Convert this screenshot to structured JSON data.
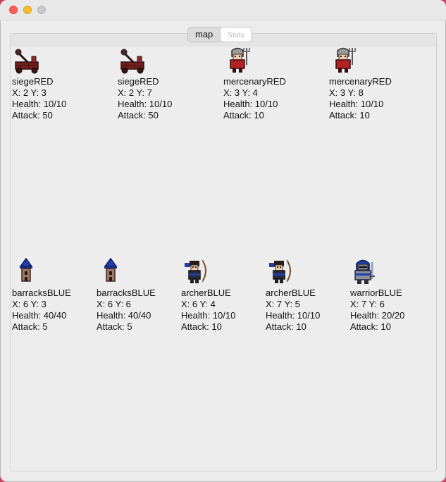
{
  "tabs": {
    "map": "map",
    "stats": "Stats"
  },
  "units_red": [
    {
      "name": "siegeRED",
      "coords": "X: 2 Y: 3",
      "health": "Health: 10/10",
      "attack": "Attack: 50",
      "icon": "catapult-icon"
    },
    {
      "name": "siegeRED",
      "coords": "X: 2 Y: 7",
      "health": "Health: 10/10",
      "attack": "Attack: 50",
      "icon": "catapult-icon"
    },
    {
      "name": "mercenaryRED",
      "coords": "X: 3 Y: 4",
      "health": "Health: 10/10",
      "attack": "Attack: 10",
      "icon": "mercenary-icon"
    },
    {
      "name": "mercenaryRED",
      "coords": "X: 3 Y: 8",
      "health": "Health: 10/10",
      "attack": "Attack: 10",
      "icon": "mercenary-icon"
    }
  ],
  "units_blue": [
    {
      "name": "barracksBLUE",
      "coords": "X: 6 Y: 3",
      "health": "Health: 40/40",
      "attack": "Attack: 5",
      "icon": "tower-icon"
    },
    {
      "name": "barracksBLUE",
      "coords": "X: 6 Y: 6",
      "health": "Health: 40/40",
      "attack": "Attack: 5",
      "icon": "tower-icon"
    },
    {
      "name": "archerBLUE",
      "coords": "X: 6 Y: 4",
      "health": "Health: 10/10",
      "attack": "Attack: 10",
      "icon": "archer-icon"
    },
    {
      "name": "archerBLUE",
      "coords": "X: 7 Y: 5",
      "health": "Health: 10/10",
      "attack": "Attack: 10",
      "icon": "archer-icon"
    },
    {
      "name": "warriorBLUE",
      "coords": "X: 7 Y: 6",
      "health": "Health: 20/20",
      "attack": "Attack: 10",
      "icon": "warrior-icon"
    }
  ],
  "colors": {
    "red_team": "#8b1f1f",
    "blue_team": "#1f3fb0"
  }
}
